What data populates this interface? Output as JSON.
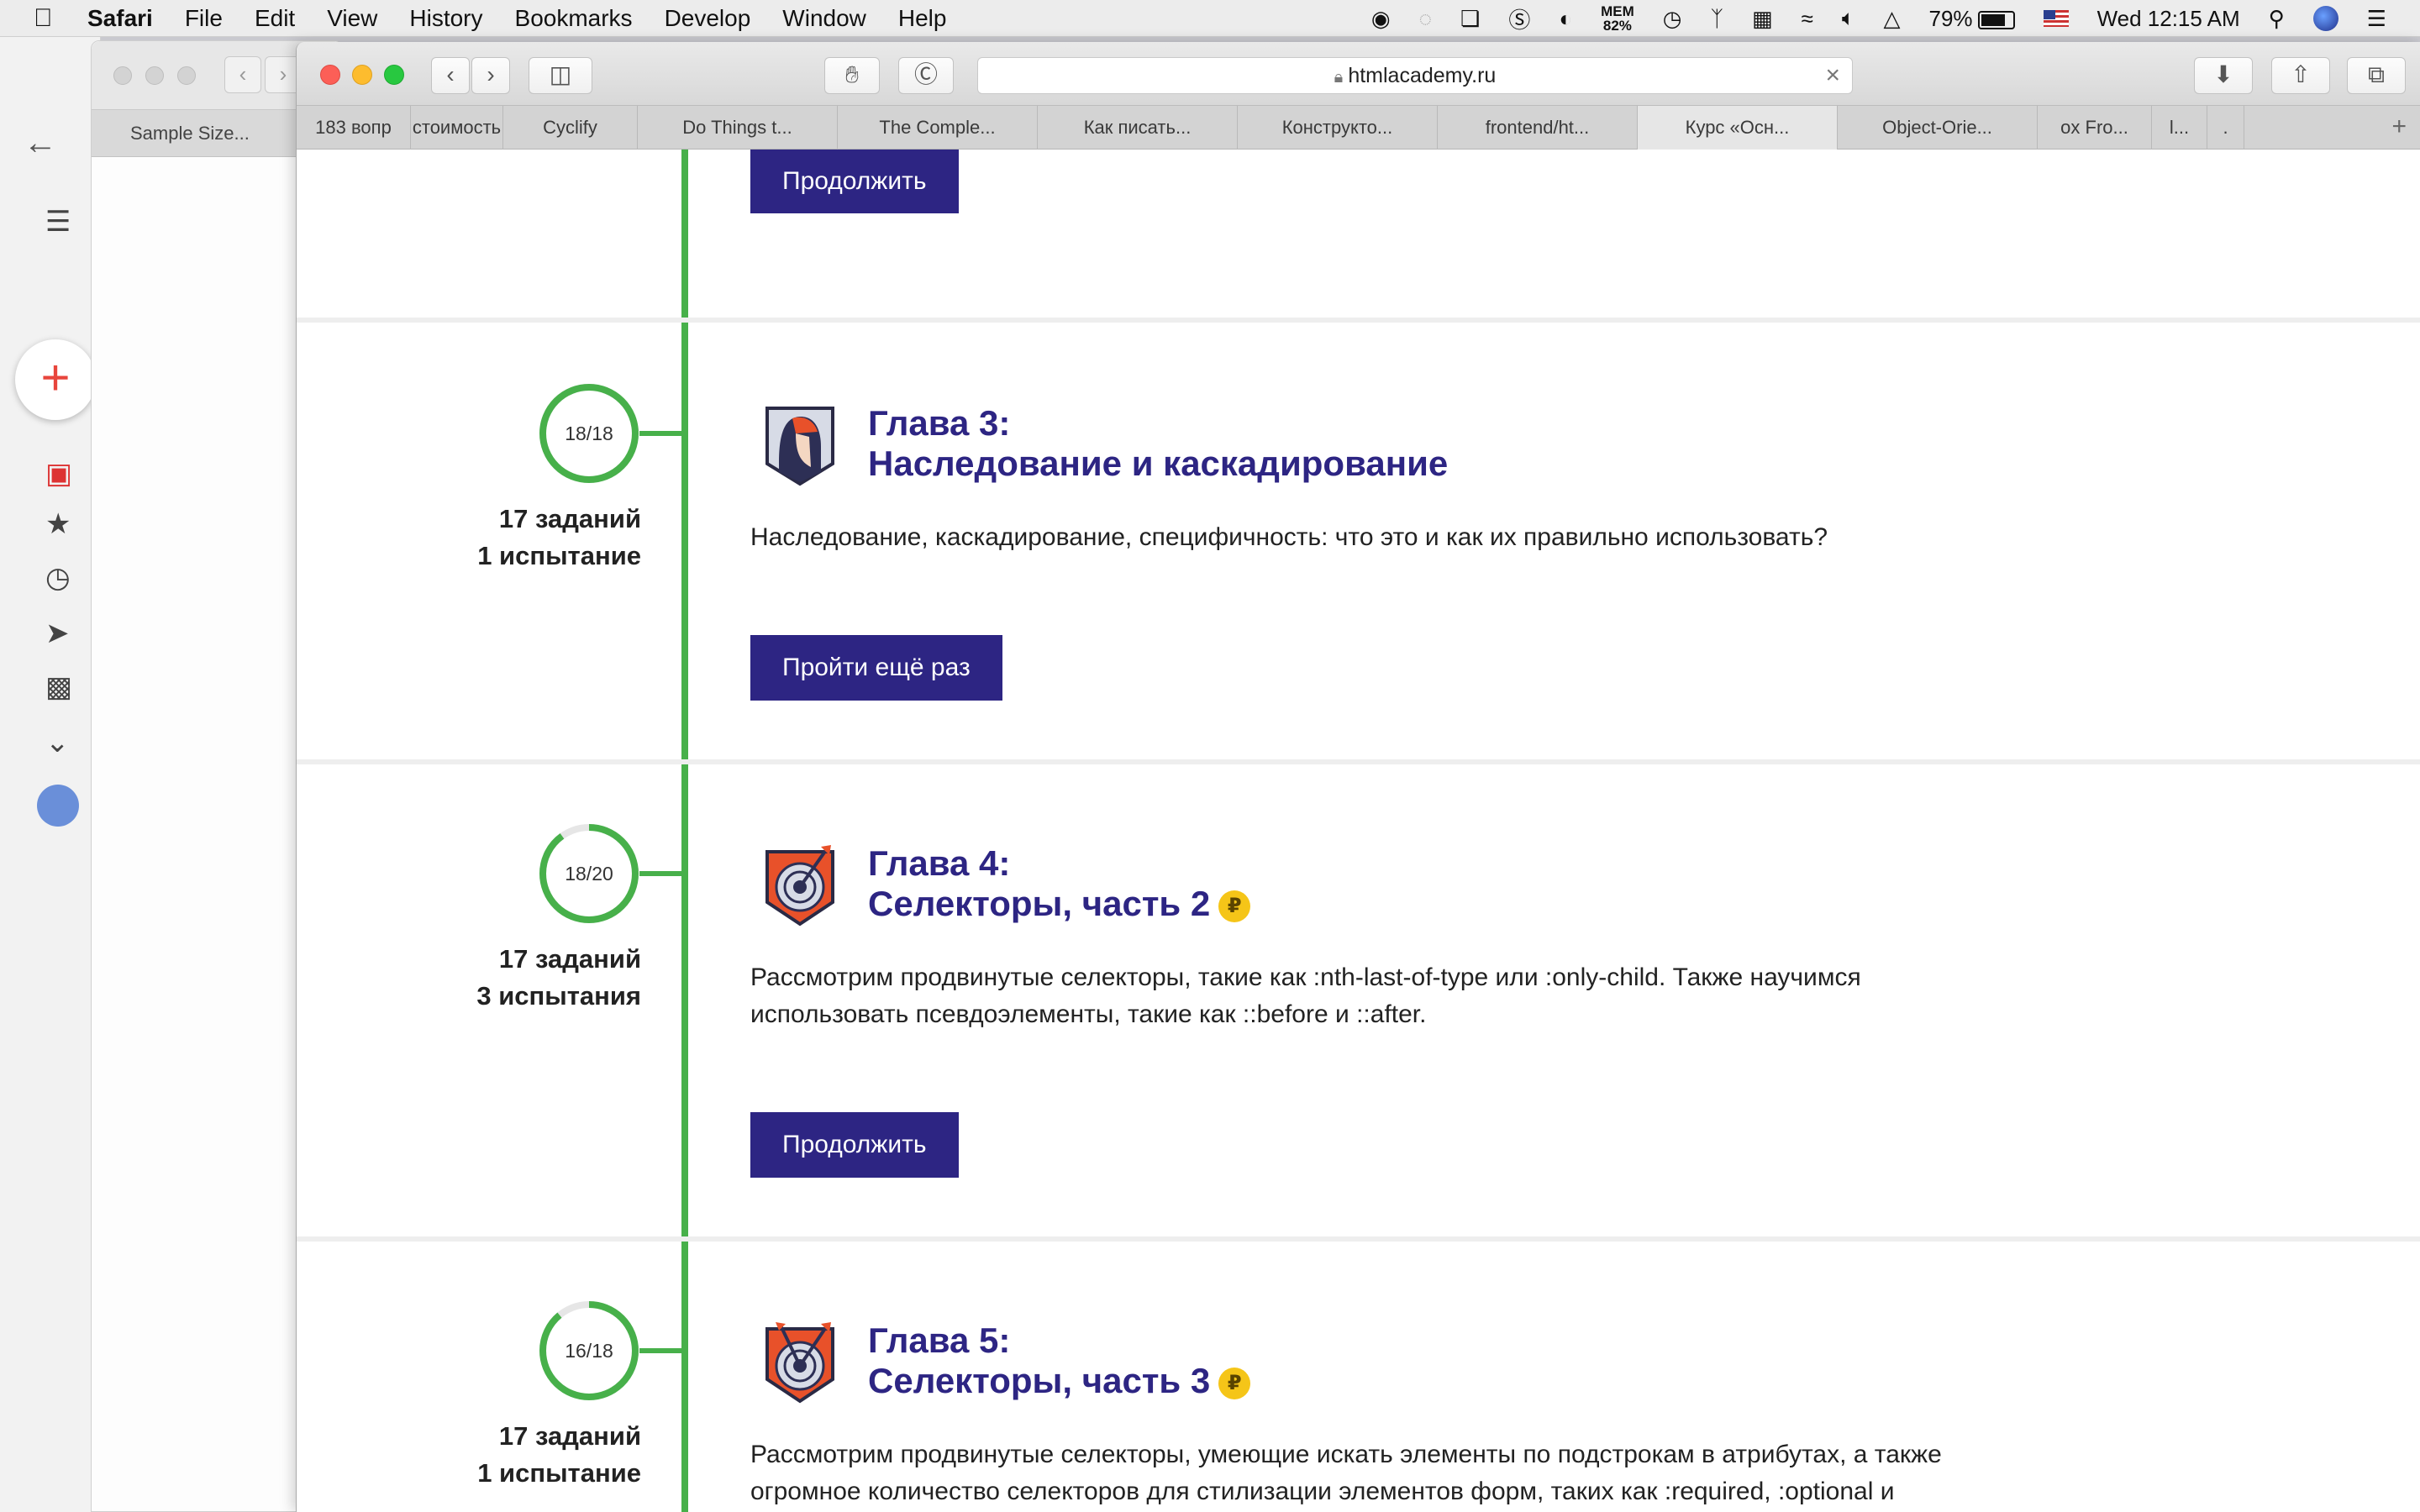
{
  "menubar": {
    "items": [
      "Safari",
      "File",
      "Edit",
      "View",
      "History",
      "Bookmarks",
      "Develop",
      "Window",
      "Help"
    ],
    "mem_label": "MEM",
    "mem_value": "82%",
    "battery": "79%",
    "battery_level": 0.79,
    "clock": "Wed 12:15 AM"
  },
  "bg_window": {
    "tab_label": "Sample Size..."
  },
  "browser": {
    "url": "htmlacademy.ru",
    "tabs": [
      {
        "label": "183 вопр"
      },
      {
        "label": "стоимость"
      },
      {
        "label": "Cyclify"
      },
      {
        "label": "Do Things t..."
      },
      {
        "label": "The Comple..."
      },
      {
        "label": "Как писать..."
      },
      {
        "label": "Конструкто..."
      },
      {
        "label": "frontend/ht..."
      },
      {
        "label": "Курс «Осн..."
      },
      {
        "label": "Object-Orie..."
      },
      {
        "label": "ox Fro..."
      },
      {
        "label": "l..."
      },
      {
        "label": "."
      }
    ],
    "new_tab": "+"
  },
  "top_chapter": {
    "button": "Продолжить"
  },
  "chapters": [
    {
      "progress": "18/18",
      "progress_value": 1.0,
      "tasks": "17 заданий",
      "tests": "1 испытание",
      "title_line1": "Глава 3:",
      "title_line2": "Наследование и каскадирование",
      "paid": false,
      "description": "Наследование, каскадирование, специфичность: что это и как их правильно использовать?",
      "button": "Пройти ещё раз",
      "badge": "helmet-icon"
    },
    {
      "progress": "18/20",
      "progress_value": 0.9,
      "tasks": "17 заданий",
      "tests": "3 испытания",
      "title_line1": "Глава 4:",
      "title_line2": "Селекторы, часть 2",
      "paid": true,
      "description": "Рассмотрим продвинутые селекторы, такие как :nth-last-of-type или :only-child. Также научимся использовать псевдоэлементы, такие как ::before и ::after.",
      "button": "Продолжить",
      "badge": "target-arrow-icon"
    },
    {
      "progress": "16/18",
      "progress_value": 0.889,
      "tasks": "17 заданий",
      "tests": "1 испытание",
      "title_line1": "Глава 5:",
      "title_line2": "Селекторы, часть 3",
      "paid": true,
      "description": "Рассмотрим продвинутые селекторы, умеющие искать элементы по подстрокам в атрибутах, а также огромное количество селекторов для стилизации элементов форм, таких как :required, :optional и :checked.",
      "button": "",
      "badge": "target-two-arrows-icon"
    }
  ],
  "colors": {
    "accent": "#2d2583",
    "timeline": "#47b04a",
    "coin": "#f5c518",
    "badge_orange": "#e8512a"
  }
}
